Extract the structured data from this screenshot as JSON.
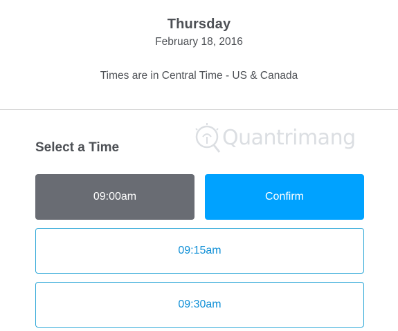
{
  "header": {
    "day": "Thursday",
    "date": "February 18, 2016",
    "timezone": "Times are in Central Time - US & Canada"
  },
  "section": {
    "title": "Select a Time"
  },
  "slots": {
    "selected_time": "09:00am",
    "confirm_label": "Confirm",
    "available": [
      "09:15am",
      "09:30am"
    ]
  },
  "watermark": {
    "brand": "Quantrimang"
  },
  "colors": {
    "selected": "#696c73",
    "confirm": "#00a2ff",
    "open_border": "#2fa8d8",
    "open_text": "#0f8fd6"
  }
}
